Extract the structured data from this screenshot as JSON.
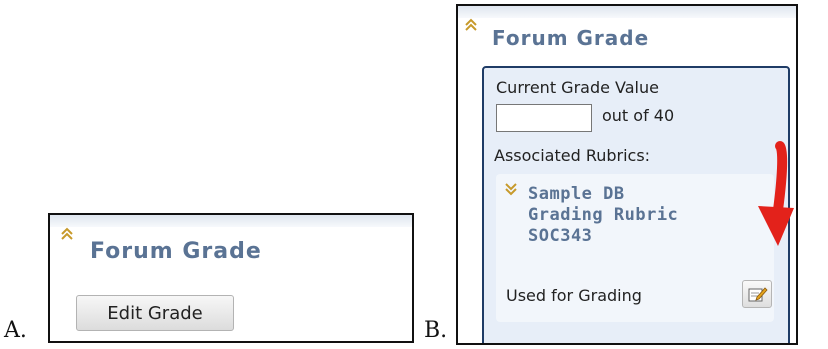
{
  "panel_a": {
    "caption": "A.",
    "title": "Forum Grade",
    "button_label": "Edit Grade"
  },
  "panel_b": {
    "caption": "B.",
    "title": "Forum Grade",
    "current_grade_label": "Current Grade Value",
    "grade_input_value": "",
    "out_of_text": "out of 40",
    "associated_rubrics_label": "Associated Rubrics:",
    "rubric_title_lines": [
      "Sample DB",
      "Grading Rubric",
      "SOC343"
    ],
    "used_for_grading_label": "Used for Grading"
  },
  "icons": {
    "collapse": "chevron-up-icon",
    "expand": "chevron-down-icon",
    "edit": "edit-pencil-icon",
    "annotation": "red-arrow-icon"
  },
  "colors": {
    "title": "#5a7394",
    "chevron": "#c79a2b",
    "grade_border": "#1f3c66",
    "grade_bg": "#e7eef8",
    "arrow": "#e3221b"
  }
}
